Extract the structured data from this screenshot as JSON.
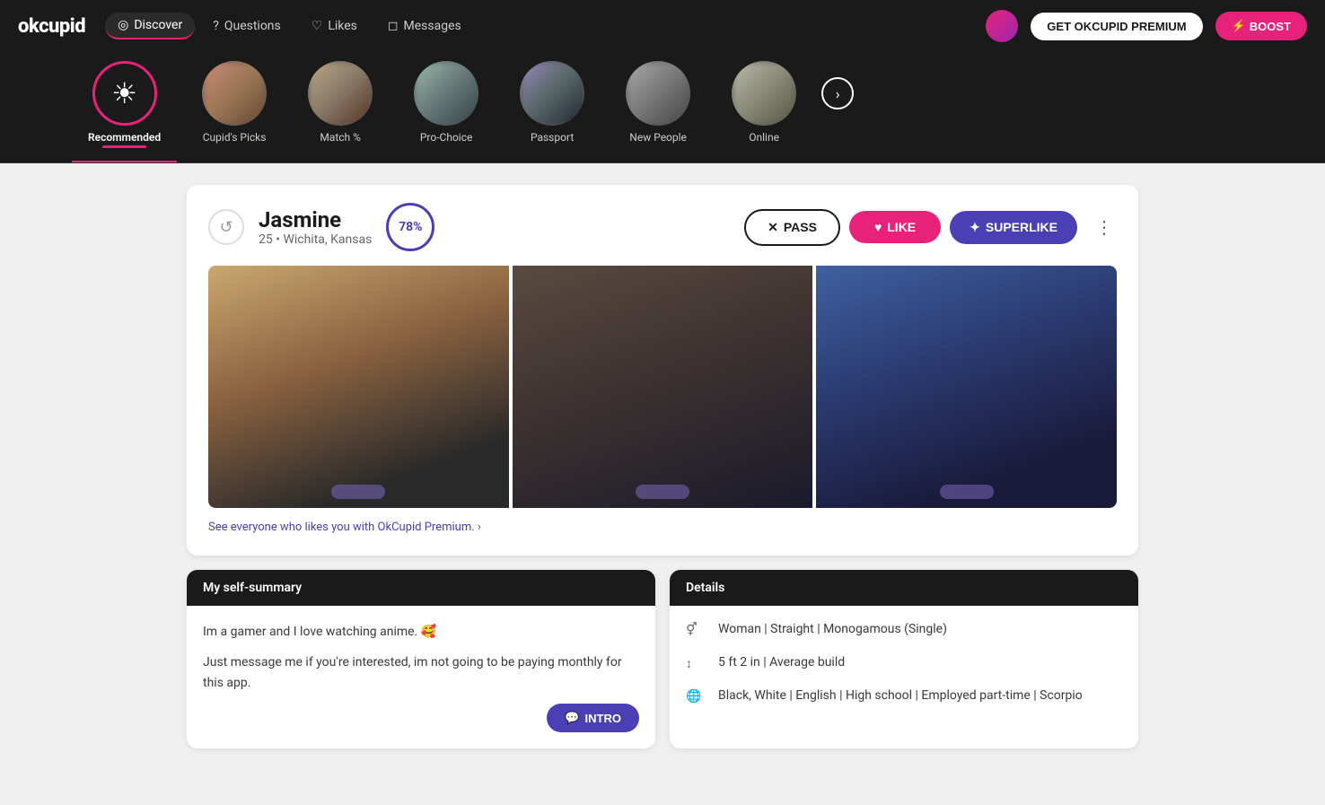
{
  "logo": "okcupid",
  "nav": {
    "items": [
      {
        "id": "discover",
        "label": "Discover",
        "icon": "discover-icon",
        "active": true
      },
      {
        "id": "questions",
        "label": "Questions",
        "icon": "questions-icon"
      },
      {
        "id": "likes",
        "label": "Likes",
        "icon": "likes-icon"
      },
      {
        "id": "messages",
        "label": "Messages",
        "icon": "messages-icon"
      }
    ],
    "btn_premium": "GET OKCUPID PREMIUM",
    "btn_boost": "BOOST"
  },
  "categories": [
    {
      "id": "recommended",
      "label": "Recommended",
      "active": true,
      "type": "icon"
    },
    {
      "id": "cupids-picks",
      "label": "Cupid's Picks"
    },
    {
      "id": "match",
      "label": "Match %"
    },
    {
      "id": "pro-choice",
      "label": "Pro-Choice"
    },
    {
      "id": "passport",
      "label": "Passport"
    },
    {
      "id": "new-people",
      "label": "New People"
    },
    {
      "id": "online",
      "label": "Online"
    }
  ],
  "profile": {
    "name": "Jasmine",
    "age": "25",
    "location": "Wichita, Kansas",
    "match_percent": "78%",
    "btn_pass": "PASS",
    "btn_like": "LIKE",
    "btn_superlike": "SUPERLIKE",
    "photos": [
      {
        "label": ""
      },
      {
        "label": ""
      },
      {
        "label": ""
      }
    ],
    "premium_cta": "See everyone who likes you with OkCupid Premium. ›",
    "self_summary_title": "My self-summary",
    "self_summary": "Im a gamer and I love watching anime. 🥰\n\nJust message me if you're interested, im not going to be paying monthly for this app.",
    "btn_intro": "INTRO",
    "details_title": "Details",
    "details": [
      {
        "icon": "gender-icon",
        "text": "Woman | Straight | Monogamous (Single)"
      },
      {
        "icon": "height-icon",
        "text": "5 ft 2 in | Average build"
      },
      {
        "icon": "globe-icon",
        "text": "Black, White | English | High school | Employed part-time | Scorpio"
      }
    ]
  }
}
